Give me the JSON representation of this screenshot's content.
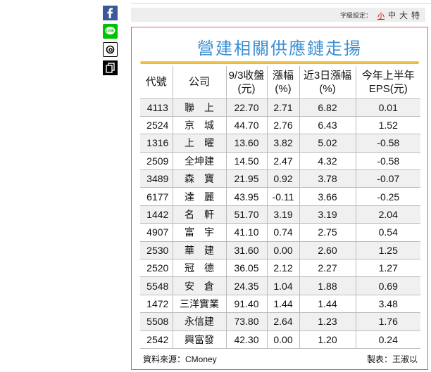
{
  "share": {
    "facebook_icon": "facebook-icon",
    "line_icon": "line-icon",
    "threads_icon": "threads-icon",
    "copy_icon": "copy-link-icon"
  },
  "font_size": {
    "label": "字級設定：",
    "small": "小",
    "medium": "中",
    "large": "大",
    "xlarge": "特"
  },
  "figure": {
    "title": "營建相關供應鏈走揚",
    "headers": {
      "code": "代號",
      "company": "公司",
      "close_l1": "9/3收盤",
      "close_l2": "(元)",
      "chg_l1": "漲幅",
      "chg_l2": "(%)",
      "three_l1": "近3日漲幅",
      "three_l2": "(%)",
      "eps_l1": "今年上半年",
      "eps_l2": "EPS(元)"
    },
    "rows": [
      {
        "code": "4113",
        "company": "聯上",
        "close": "22.70",
        "chg": "2.71",
        "three": "6.82",
        "eps": "0.01"
      },
      {
        "code": "2524",
        "company": "京城",
        "close": "44.70",
        "chg": "2.76",
        "three": "6.43",
        "eps": "1.52"
      },
      {
        "code": "1316",
        "company": "上曜",
        "close": "13.60",
        "chg": "3.82",
        "three": "5.02",
        "eps": "-0.58"
      },
      {
        "code": "2509",
        "company": "全坤建",
        "close": "14.50",
        "chg": "2.47",
        "three": "4.32",
        "eps": "-0.58"
      },
      {
        "code": "3489",
        "company": "森寶",
        "close": "21.95",
        "chg": "0.92",
        "three": "3.78",
        "eps": "-0.07"
      },
      {
        "code": "6177",
        "company": "達麗",
        "close": "43.95",
        "chg": "-0.11",
        "three": "3.66",
        "eps": "-0.25"
      },
      {
        "code": "1442",
        "company": "名軒",
        "close": "51.70",
        "chg": "3.19",
        "three": "3.19",
        "eps": "2.04"
      },
      {
        "code": "4907",
        "company": "富宇",
        "close": "41.10",
        "chg": "0.74",
        "three": "2.75",
        "eps": "0.54"
      },
      {
        "code": "2530",
        "company": "華建",
        "close": "31.60",
        "chg": "0.00",
        "three": "2.60",
        "eps": "1.25"
      },
      {
        "code": "2520",
        "company": "冠德",
        "close": "36.05",
        "chg": "2.12",
        "three": "2.27",
        "eps": "1.27"
      },
      {
        "code": "5548",
        "company": "安倉",
        "close": "24.35",
        "chg": "1.04",
        "three": "1.88",
        "eps": "0.69"
      },
      {
        "code": "1472",
        "company": "三洋實業",
        "close": "91.40",
        "chg": "1.44",
        "three": "1.44",
        "eps": "3.48"
      },
      {
        "code": "5508",
        "company": "永信建",
        "close": "73.80",
        "chg": "2.64",
        "three": "1.23",
        "eps": "1.76"
      },
      {
        "code": "2542",
        "company": "興富發",
        "close": "42.30",
        "chg": "0.00",
        "three": "1.20",
        "eps": "0.24"
      }
    ],
    "source": "資料來源：CMoney",
    "maker": "製表：王淑以"
  },
  "colors": {
    "title": "#3b8fd4",
    "rule": "#f0c24a",
    "border": "#e06060",
    "facebook": "#3b5998",
    "line": "#00c300"
  }
}
